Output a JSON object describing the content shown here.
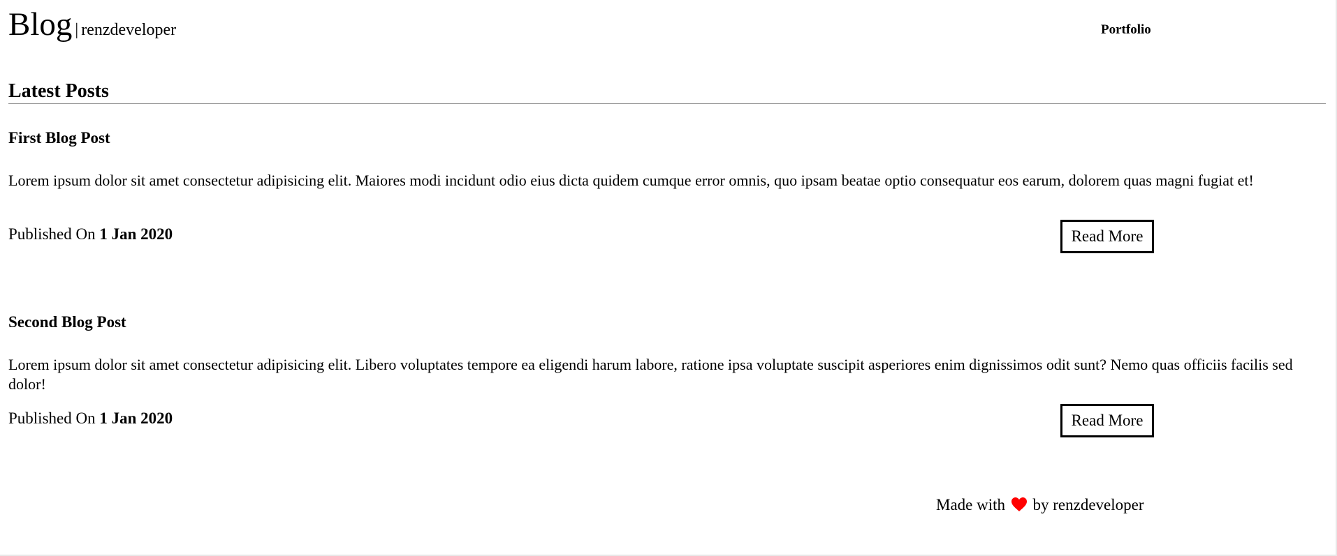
{
  "header": {
    "brand_title": "Blog",
    "brand_separator": "|",
    "brand_subtitle": "renzdeveloper",
    "nav": {
      "portfolio_label": "Portfolio"
    }
  },
  "section": {
    "title": "Latest Posts"
  },
  "posts": [
    {
      "title": "First Blog Post",
      "excerpt": "Lorem ipsum dolor sit amet consectetur adipisicing elit. Maiores modi incidunt odio eius dicta quidem cumque error omnis, quo ipsam beatae optio consequatur eos earum, dolorem quas magni fugiat et!",
      "published_label": "Published On",
      "date": "1 Jan 2020",
      "read_more_label": "Read More"
    },
    {
      "title": "Second Blog Post",
      "excerpt": "Lorem ipsum dolor sit amet consectetur adipisicing elit. Libero voluptates tempore ea eligendi harum labore, ratione ipsa voluptate suscipit asperiores enim dignissimos odit sunt? Nemo quas officiis facilis sed dolor!",
      "published_label": "Published On",
      "date": "1 Jan 2020",
      "read_more_label": "Read More"
    }
  ],
  "footer": {
    "made_with": "Made with",
    "by_text": "by renzdeveloper",
    "icon": "heart-icon",
    "heart_color": "#ff0000"
  }
}
